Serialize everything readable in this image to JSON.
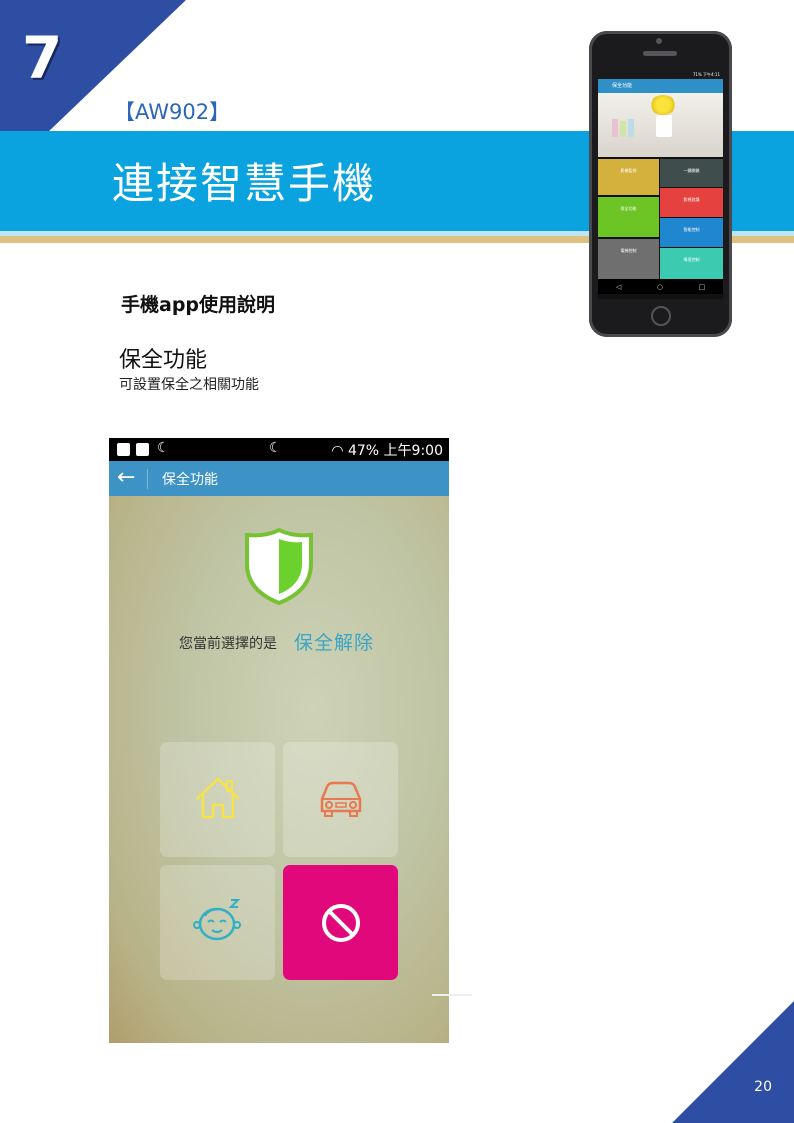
{
  "chapter": "7",
  "model": "【AW902】",
  "title": "連接智慧手機",
  "subhead": "手機app使用說明",
  "section": {
    "title": "保全功能",
    "description": "可設置保全之相關功能"
  },
  "small_phone": {
    "status": "71% 下午4:11",
    "app_title": "保全功能",
    "tiles": [
      {
        "label": "影像監視",
        "color": "#d4b13c"
      },
      {
        "label": "一鍵開鎖",
        "color": "#3f4d4d"
      },
      {
        "label": "影視對講",
        "color": "#e4413f"
      },
      {
        "label": "保全功能",
        "color": "#6cc524"
      },
      {
        "label": "智能控制",
        "color": "#1f86d0"
      },
      {
        "label": "電梯控制",
        "color": "#6f6f6f"
      },
      {
        "label": "情境控制",
        "color": "#3ccab0"
      }
    ],
    "nav": [
      "◁",
      "○",
      "□"
    ]
  },
  "screenshot": {
    "status_right": "47% 上午9:00",
    "app_bar_title": "保全功能",
    "mode_label": "您當前選擇的是",
    "mode_value": "保全解除",
    "tiles": [
      {
        "icon": "home-icon",
        "color": "#f6e34a",
        "active": false
      },
      {
        "icon": "car-icon",
        "color": "#e7784f",
        "active": false
      },
      {
        "icon": "baby-icon",
        "color": "#2fb0c5",
        "active": false
      },
      {
        "icon": "disarm-icon",
        "color": "#ffffff",
        "active": true,
        "tile_color": "#e0087a"
      }
    ]
  },
  "page_number": "20",
  "colors": {
    "brand_blue": "#2d4ea3",
    "title_bar": "#0aa3df",
    "gold_rule": "#ddc17e"
  }
}
